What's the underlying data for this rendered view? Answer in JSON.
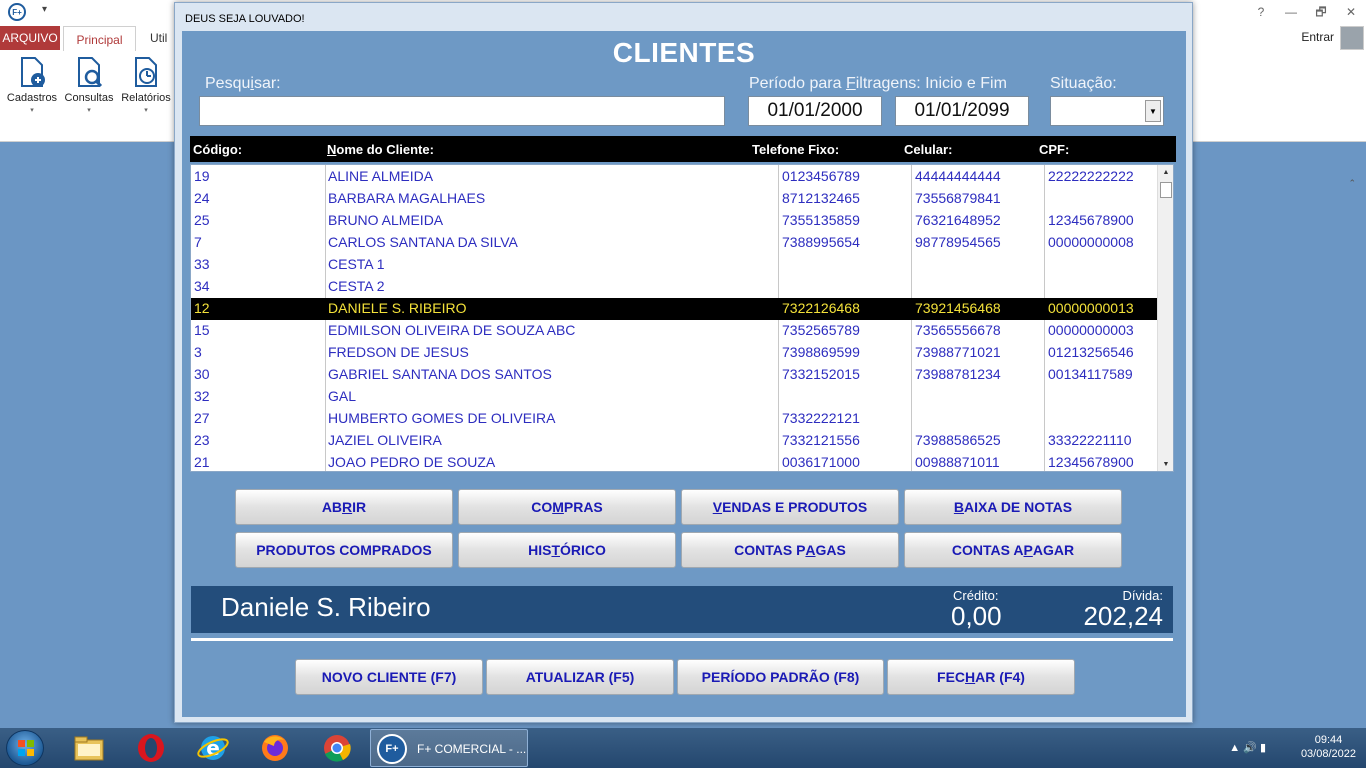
{
  "app": {
    "logo": "F+",
    "qat": "▾",
    "tabs": {
      "arquivo": "ARQUIVO",
      "principal": "Principal",
      "util": "Util"
    },
    "ribbon": [
      {
        "label": "Cadastros"
      },
      {
        "label": "Consultas"
      },
      {
        "label": "Relatórios"
      }
    ],
    "caret": "▾",
    "entrar": "Entrar",
    "winctrls": {
      "help": "?",
      "min": "—",
      "restore": "🗗",
      "close": "✕"
    },
    "collapse": "⌃"
  },
  "dialog": {
    "title": "DEUS SEJA LOUVADO!",
    "heading": "CLIENTES",
    "search_label_pre": "Pesqu",
    "search_label_u": "i",
    "search_label_post": "sar:",
    "search_value": "",
    "period_label_pre": "Período para ",
    "period_label_u": "F",
    "period_label_post": "iltragens: Inicio e Fim",
    "date_start": "01/01/2000",
    "date_end": "01/01/2099",
    "situacao_label": "Situação:",
    "situacao_value": "",
    "situacao_arrow": "▼"
  },
  "grid": {
    "headers": {
      "codigo": "Código:",
      "nome_u": "N",
      "nome_rest": "ome do Cliente:",
      "fixo": "Telefone Fixo:",
      "celular": "Celular:",
      "cpf": "CPF:"
    },
    "selected_index": 6,
    "rows": [
      {
        "codigo": "19",
        "nome": "ALINE ALMEIDA",
        "fixo": "0123456789",
        "celular": "44444444444",
        "cpf": "22222222222"
      },
      {
        "codigo": "24",
        "nome": "BARBARA MAGALHAES",
        "fixo": "8712132465",
        "celular": "73556879841",
        "cpf": ""
      },
      {
        "codigo": "25",
        "nome": "BRUNO ALMEIDA",
        "fixo": "7355135859",
        "celular": "76321648952",
        "cpf": "12345678900"
      },
      {
        "codigo": "7",
        "nome": "CARLOS SANTANA DA SILVA",
        "fixo": "7388995654",
        "celular": "98778954565",
        "cpf": "00000000008"
      },
      {
        "codigo": "33",
        "nome": "CESTA 1",
        "fixo": "",
        "celular": "",
        "cpf": ""
      },
      {
        "codigo": "34",
        "nome": "CESTA 2",
        "fixo": "",
        "celular": "",
        "cpf": ""
      },
      {
        "codigo": "12",
        "nome": "DANIELE S. RIBEIRO",
        "fixo": "7322126468",
        "celular": "73921456468",
        "cpf": "00000000013"
      },
      {
        "codigo": "15",
        "nome": "EDMILSON OLIVEIRA DE SOUZA ABC",
        "fixo": "7352565789",
        "celular": "73565556678",
        "cpf": "00000000003"
      },
      {
        "codigo": "3",
        "nome": "FREDSON DE JESUS",
        "fixo": "7398869599",
        "celular": "73988771021",
        "cpf": "01213256546"
      },
      {
        "codigo": "30",
        "nome": "GABRIEL SANTANA DOS SANTOS",
        "fixo": "7332152015",
        "celular": "73988781234",
        "cpf": "00134117589"
      },
      {
        "codigo": "32",
        "nome": "GAL",
        "fixo": "",
        "celular": "",
        "cpf": ""
      },
      {
        "codigo": "27",
        "nome": "HUMBERTO GOMES DE OLIVEIRA",
        "fixo": "7332222121",
        "celular": "",
        "cpf": ""
      },
      {
        "codigo": "23",
        "nome": "JAZIEL OLIVEIRA",
        "fixo": "7332121556",
        "celular": "73988586525",
        "cpf": "33322221110"
      },
      {
        "codigo": "21",
        "nome": "JOAO PEDRO DE SOUZA",
        "fixo": "0036171000",
        "celular": "00988871011",
        "cpf": "12345678900"
      }
    ],
    "scroll_up": "▲",
    "scroll_down": "▼"
  },
  "buttons": {
    "abrir": {
      "pre": "AB",
      "u": "R",
      "post": "IR"
    },
    "compras": {
      "pre": "CO",
      "u": "M",
      "post": "PRAS"
    },
    "vendas": {
      "pre": "",
      "u": "V",
      "post": "ENDAS E PRODUTOS"
    },
    "baixa": {
      "pre": "",
      "u": "B",
      "post": "AIXA DE NOTAS"
    },
    "produtos": {
      "pre": "PRODUTOS COMPRADOS",
      "u": "",
      "post": ""
    },
    "historico": {
      "pre": "HIS",
      "u": "T",
      "post": "ÓRICO"
    },
    "contas_pagas": {
      "pre": "CONTAS P",
      "u": "A",
      "post": "GAS"
    },
    "contas_pagar": {
      "pre": "CONTAS A ",
      "u": "P",
      "post": "AGAR"
    },
    "novo": {
      "pre": "NOVO CLIENTE  (F7)",
      "u": "",
      "post": ""
    },
    "atualizar": {
      "pre": "ATUALIZAR  (F5)",
      "u": "",
      "post": ""
    },
    "periodo": {
      "pre": "PERÍODO PADRÃO (F8)",
      "u": "",
      "post": ""
    },
    "fechar": {
      "pre": "FEC",
      "u": "H",
      "post": "AR (F4)"
    }
  },
  "info": {
    "name": "Daniele S. Ribeiro",
    "credito_label": "Crédito:",
    "credito_value": "0,00",
    "divida_label": "Dívida:",
    "divida_value": "202,24"
  },
  "taskbar": {
    "task_logo": "F+",
    "task_label": "F+ COMERCIAL - ...",
    "tray_icons": "▲  🔊  ▮",
    "time": "09:44",
    "date": "03/08/2022"
  }
}
